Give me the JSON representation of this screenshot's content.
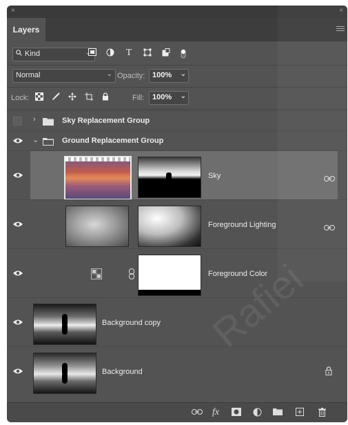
{
  "panel": {
    "tab_label": "Layers",
    "close_glyph": "×",
    "collapse_glyph": "«"
  },
  "filter": {
    "kind_label": "Kind",
    "icons": [
      "image-filter-icon",
      "adjustment-filter-icon",
      "type-filter-icon",
      "shape-filter-icon",
      "smart-object-filter-icon",
      "filter-toggle-icon"
    ]
  },
  "blend": {
    "mode": "Normal",
    "opacity_label": "Opacity:",
    "opacity_value": "100%"
  },
  "lock": {
    "label": "Lock:",
    "fill_label": "Fill:",
    "fill_value": "100%"
  },
  "layers": [
    {
      "name": "Sky Replacement Group",
      "type": "group",
      "expanded": false,
      "visible": false
    },
    {
      "name": "Ground Replacement Group",
      "type": "group",
      "expanded": true,
      "visible": true
    },
    {
      "name": "Sky",
      "type": "layer",
      "selected": true,
      "linked": true
    },
    {
      "name": "Foreground Lighting",
      "type": "layer",
      "linked": true
    },
    {
      "name": "Foreground Color",
      "type": "fill-layer"
    },
    {
      "name": "Background copy",
      "type": "layer"
    },
    {
      "name": "Background",
      "type": "layer",
      "locked": true
    }
  ],
  "footer": {
    "fx_label": "fx"
  },
  "watermark": "Rafiei",
  "colors": {
    "panel_bg": "#535353",
    "selected_row": "#6e6e6e",
    "tab_bg": "#3d3d3d"
  }
}
